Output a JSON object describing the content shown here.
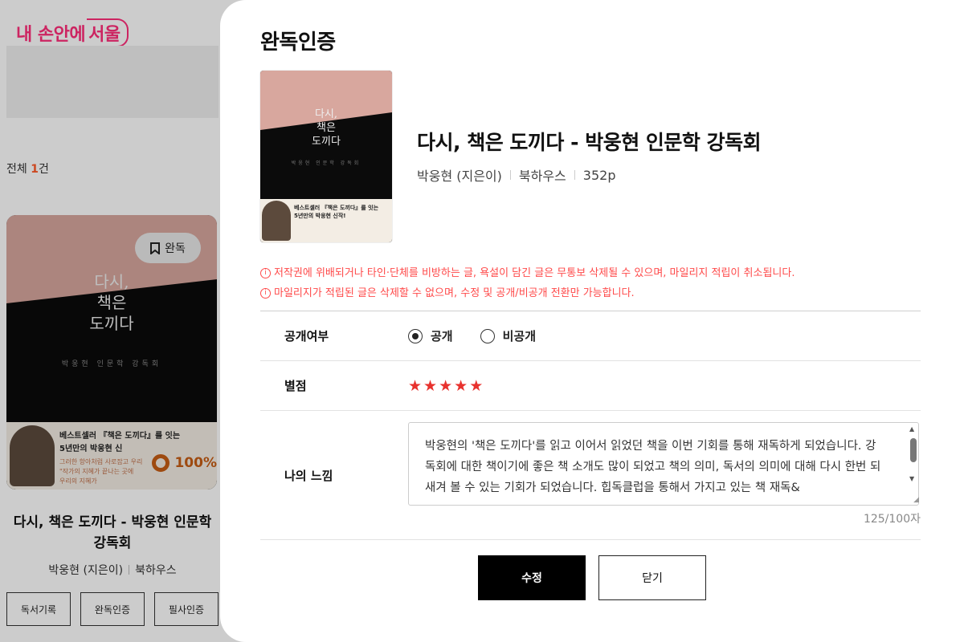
{
  "background": {
    "logo": {
      "part1": "내 손안에",
      "part2": "서울"
    },
    "total": {
      "prefix": "전체",
      "count": "1",
      "suffix": "건"
    },
    "card": {
      "badge_label": "완독",
      "cover_title_line1": "다시,",
      "cover_title_line2": "책은",
      "cover_title_line3": "도끼다",
      "cover_subtitle": "박웅현 인문학 강독회",
      "cover_blurb_line1": "베스트셀러 『책은 도끼다』를 잇는",
      "cover_blurb_line2": "5년만의 박웅현 신",
      "cover_blurb_line3": "그러한 항아처럼 사로잡고 우리",
      "cover_quote_line1": "\"작가의 지혜가 끝나는 곳에",
      "cover_quote_line2": "우리의 지혜가",
      "progress": "100%",
      "title": "다시, 책은 도끼다 - 박웅현 인문학 강독회",
      "author": "박웅현 (지은이)",
      "publisher": "북하우스",
      "buttons": [
        "독서기록",
        "완독인증",
        "필사인증"
      ]
    }
  },
  "modal": {
    "title": "완독인증",
    "book": {
      "cover_title_line1": "다시,",
      "cover_title_line2": "책은",
      "cover_title_line3": "도끼다",
      "cover_subtitle": "박웅현 인문학 강독회",
      "cover_blurb_line1": "베스트셀러 『책은 도끼다』를 잇는",
      "cover_blurb_line2": "5년만의 박웅현 신작!",
      "title": "다시, 책은 도끼다 - 박웅현 인문학 강독회",
      "author": "박웅현 (지은이)",
      "publisher": "북하우스",
      "pages": "352p"
    },
    "notices": [
      "저작권에 위배되거나 타인·단체를 비방하는 글, 욕설이 담긴 글은 무통보 삭제될 수 있으며, 마일리지 적립이 취소됩니다.",
      "마일리지가 적립된 글은 삭제할 수 없으며, 수정 및 공개/비공개 전환만 가능합니다."
    ],
    "form": {
      "public_label": "공개여부",
      "public_options": [
        "공개",
        "비공개"
      ],
      "public_selected": "공개",
      "rating_label": "별점",
      "rating": 5,
      "rating_max": 5,
      "feeling_label": "나의 느낌",
      "feeling_text": "박웅현의 '책은 도끼다'를 읽고 이어서 읽었던 책을 이번 기회를 통해 재독하게 되었습니다. 강독회에 대한 책이기에 좋은 책 소개도 많이 되었고 책의 의미, 독서의 의미에 대해 다시 한번 되새겨 볼 수 있는 기회가 되었습니다. 힙독클럽을 통해서 가지고 있는 책 재독&",
      "char_count": "125/100자"
    },
    "buttons": {
      "submit": "수정",
      "close": "닫기"
    }
  },
  "colors": {
    "brand_pink": "#ff2d7a",
    "warning_red": "#ff4a4a",
    "star_red": "#e8322e",
    "progress_orange": "#c65d15"
  },
  "icons": [
    "bookmark-icon",
    "info-icon",
    "star-icon",
    "radio-icon",
    "scroll-up-icon",
    "scroll-down-icon",
    "resize-grip-icon"
  ]
}
